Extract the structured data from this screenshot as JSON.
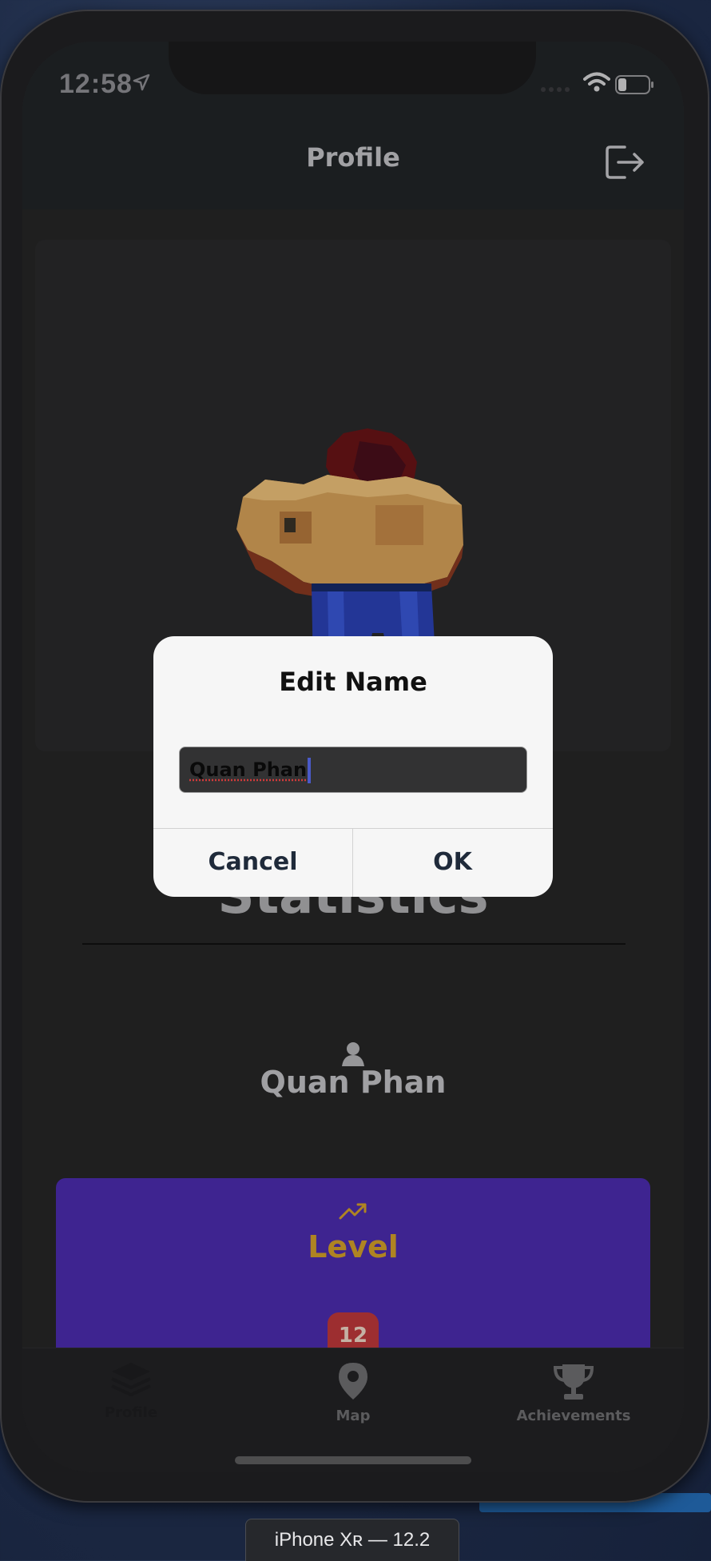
{
  "status_bar": {
    "time": "12:58"
  },
  "header": {
    "title": "Profile"
  },
  "statistics": {
    "title": "Statistics",
    "player_name": "Quan Phan"
  },
  "level_card": {
    "label": "Level",
    "value": "12"
  },
  "tabs": [
    {
      "label": "Profile",
      "icon": "layers-icon",
      "active": true
    },
    {
      "label": "Map",
      "icon": "map-pin-icon",
      "active": false
    },
    {
      "label": "Achievements",
      "icon": "trophy-icon",
      "active": false
    }
  ],
  "dialog": {
    "title": "Edit Name",
    "input_value": "Quan Phan",
    "cancel_label": "Cancel",
    "ok_label": "OK"
  },
  "simulator": {
    "caption": "iPhone Xʀ — 12.2"
  },
  "colors": {
    "level_card_bg": "#4c2db0",
    "level_accent": "#d6a22a",
    "level_badge": "#c0393b",
    "dialog_bg": "#f6f6f6"
  }
}
